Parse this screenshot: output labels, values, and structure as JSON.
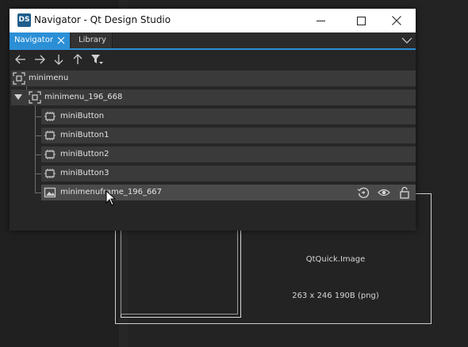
{
  "window": {
    "app_icon_text": "DS",
    "title": "Navigator - Qt Design Studio"
  },
  "tabs": [
    {
      "label": "Navigator",
      "active": true
    },
    {
      "label": "Library",
      "active": false
    }
  ],
  "toolbar": {
    "icons": [
      "back-icon",
      "forward-icon",
      "move-down-icon",
      "move-up-icon",
      "filter-icon"
    ]
  },
  "tree": {
    "root": {
      "label": "minimenu",
      "icon": "item-icon"
    },
    "group": {
      "label": "minimenu_196_668",
      "icon": "item-icon",
      "expanded": true
    },
    "children": [
      {
        "label": "miniButton",
        "icon": "component-icon"
      },
      {
        "label": "miniButton1",
        "icon": "component-icon"
      },
      {
        "label": "miniButton2",
        "icon": "component-icon"
      },
      {
        "label": "miniButton3",
        "icon": "component-icon"
      },
      {
        "label": "minimenuframe_196_667",
        "icon": "image-icon",
        "selected": true
      }
    ],
    "row_actions": [
      "reset-icon",
      "visibility-icon",
      "lock-icon"
    ]
  },
  "preview": {
    "type": "QtQuick.Image",
    "info": "263 x 246 190B (png)"
  },
  "colors": {
    "accent": "#2b8fd6",
    "row_bg": "#3a3a3a",
    "row_selected_bg": "#4a4a4a",
    "panel_bg": "#262626"
  }
}
